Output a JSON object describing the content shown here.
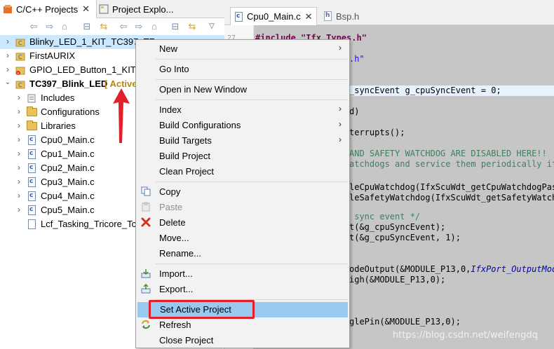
{
  "left_tabs": [
    {
      "label": "C/C++ Projects",
      "close": "✕"
    },
    {
      "label": "Project Explo..."
    }
  ],
  "toolbar_icons": [
    "back-icon",
    "forward-icon",
    "home-icon",
    "collapse-all-icon",
    "link-editor-icon",
    "back-icon-2",
    "forward-icon-2",
    "home-icon-2",
    "collapse-all-icon-2",
    "link-editor-icon-2",
    "view-menu-icon"
  ],
  "tree": [
    {
      "label": "Blinky_LED_1_KIT_TC397_TF..."
    },
    {
      "label": "FirstAURIX"
    },
    {
      "label": "GPIO_LED_Button_1_KIT_TC"
    },
    {
      "label": "TC397_Blink_LED",
      "suffix": "[ Active"
    },
    {
      "label": "Includes"
    },
    {
      "label": "Configurations"
    },
    {
      "label": "Libraries"
    },
    {
      "label": "Cpu0_Main.c",
      "icon_letter": "c"
    },
    {
      "label": "Cpu1_Main.c",
      "icon_letter": "c"
    },
    {
      "label": "Cpu2_Main.c",
      "icon_letter": "c"
    },
    {
      "label": "Cpu3_Main.c",
      "icon_letter": "c"
    },
    {
      "label": "Cpu4_Main.c",
      "icon_letter": "c"
    },
    {
      "label": "Cpu5_Main.c",
      "icon_letter": "c"
    },
    {
      "label": "Lcf_Tasking_Tricore_Tc."
    }
  ],
  "editor_tabs": [
    {
      "label": "Cpu0_Main.c",
      "close": "✕"
    },
    {
      "label": "Bsp.h"
    }
  ],
  "line_numbers": [
    "27"
  ],
  "code_lines": [
    "#include \"Ifx_Types.h\"",
    ".h\"",
    "_syncEvent g_cpuSyncEvent = 0;",
    "d)",
    "terrupts();",
    "AND SAFETY WATCHDOG ARE DISABLED HERE!!",
    "atchdogs and service them periodically if",
    "leCpuWatchdog(IfxScuWdt_getCpuWatchdogPass",
    "leSafetyWatchdog(IfxScuWdt_getSafetyWatchd",
    " sync event */",
    "t(&g_cpuSyncEvent);",
    "t(&g_cpuSyncEvent, 1);",
    "odeOutput(&MODULE_P13,0,",
    "IfxPort_OutputMode",
    "igh(&MODULE_P13,0);",
    "glePin(&MODULE_P13,0);"
  ],
  "menu": {
    "new": "New",
    "go_into": "Go Into",
    "open_new_window": "Open in New Window",
    "index": "Index",
    "build_configurations": "Build Configurations",
    "build_targets": "Build Targets",
    "build_project": "Build Project",
    "clean_project": "Clean Project",
    "copy": "Copy",
    "paste": "Paste",
    "delete": "Delete",
    "move": "Move...",
    "rename": "Rename...",
    "import": "Import...",
    "export": "Export...",
    "set_active_project": "Set Active Project",
    "refresh": "Refresh",
    "close_project": "Close Project",
    "submenu_arrow": "›"
  },
  "colors": {
    "highlight_box": "#e0202a",
    "arrow": "#e0202a",
    "menu_hover": "#99c9ef",
    "active_label": "#b8860b"
  },
  "watermark": "https://blog.csdn.net/weifengdq"
}
